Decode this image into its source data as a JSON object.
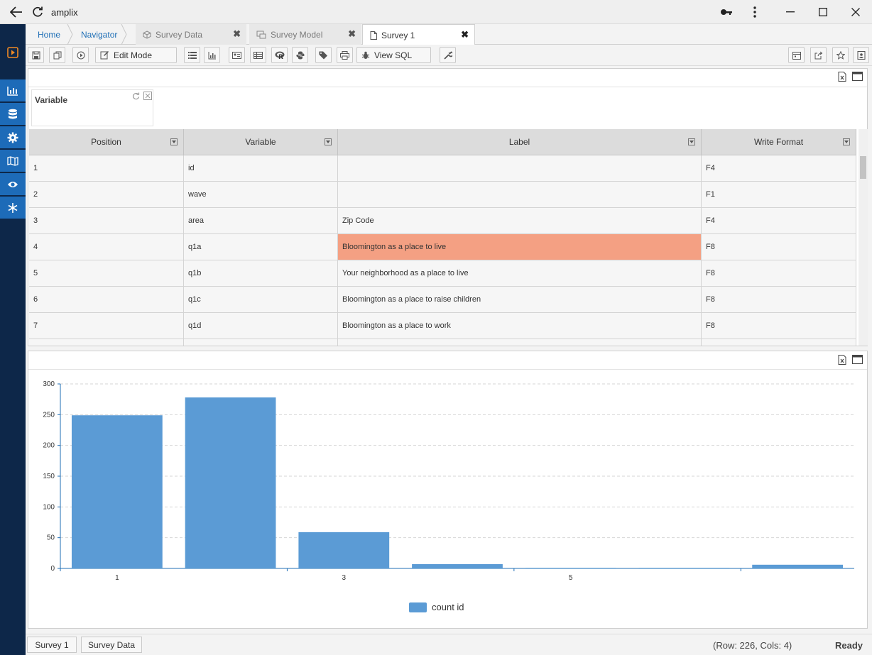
{
  "window": {
    "title": "amplix"
  },
  "tabs": [
    {
      "label": "Home"
    },
    {
      "label": "Navigator"
    },
    {
      "label": "Survey Data"
    },
    {
      "label": "Survey Model"
    },
    {
      "label": "Survey 1"
    }
  ],
  "toolbar": {
    "edit_mode": "Edit Mode",
    "view_sql": "View SQL"
  },
  "filter": {
    "title": "Variable"
  },
  "table": {
    "columns": [
      "Position",
      "Variable",
      "Label",
      "Write Format"
    ],
    "rows": [
      [
        "1",
        "id",
        "",
        "F4"
      ],
      [
        "2",
        "wave",
        "",
        "F1"
      ],
      [
        "3",
        "area",
        "Zip Code",
        "F4"
      ],
      [
        "4",
        "q1a",
        "Bloomington as a place to live",
        "F8"
      ],
      [
        "5",
        "q1b",
        "Your neighborhood as a place to live",
        "F8"
      ],
      [
        "6",
        "q1c",
        "Bloomington as a place to raise children",
        "F8"
      ],
      [
        "7",
        "q1d",
        "Bloomington as a place to work",
        "F8"
      ]
    ]
  },
  "chart_data": {
    "type": "bar",
    "categories": [
      "1",
      "2",
      "3",
      "4",
      "5",
      "6",
      "7"
    ],
    "x_tick_labels": [
      "1",
      "3",
      "5"
    ],
    "series": [
      {
        "name": "count id",
        "values": [
          249,
          278,
          59,
          7,
          1,
          1,
          6
        ]
      }
    ],
    "ylim": [
      0,
      300
    ],
    "y_ticks": [
      0,
      50,
      100,
      150,
      200,
      250,
      300
    ],
    "grid": true,
    "legend_position": "bottom",
    "color": "#5b9bd5"
  },
  "status": {
    "bottom_tabs": [
      "Survey 1",
      "Survey Data"
    ],
    "row_col": "(Row: 226, Cols: 4)",
    "state": "Ready"
  },
  "colors": {
    "sidebar": "#0d2749",
    "accent": "#1d6bb8",
    "highlight_row": "#f4a083",
    "bar": "#5b9bd5"
  }
}
